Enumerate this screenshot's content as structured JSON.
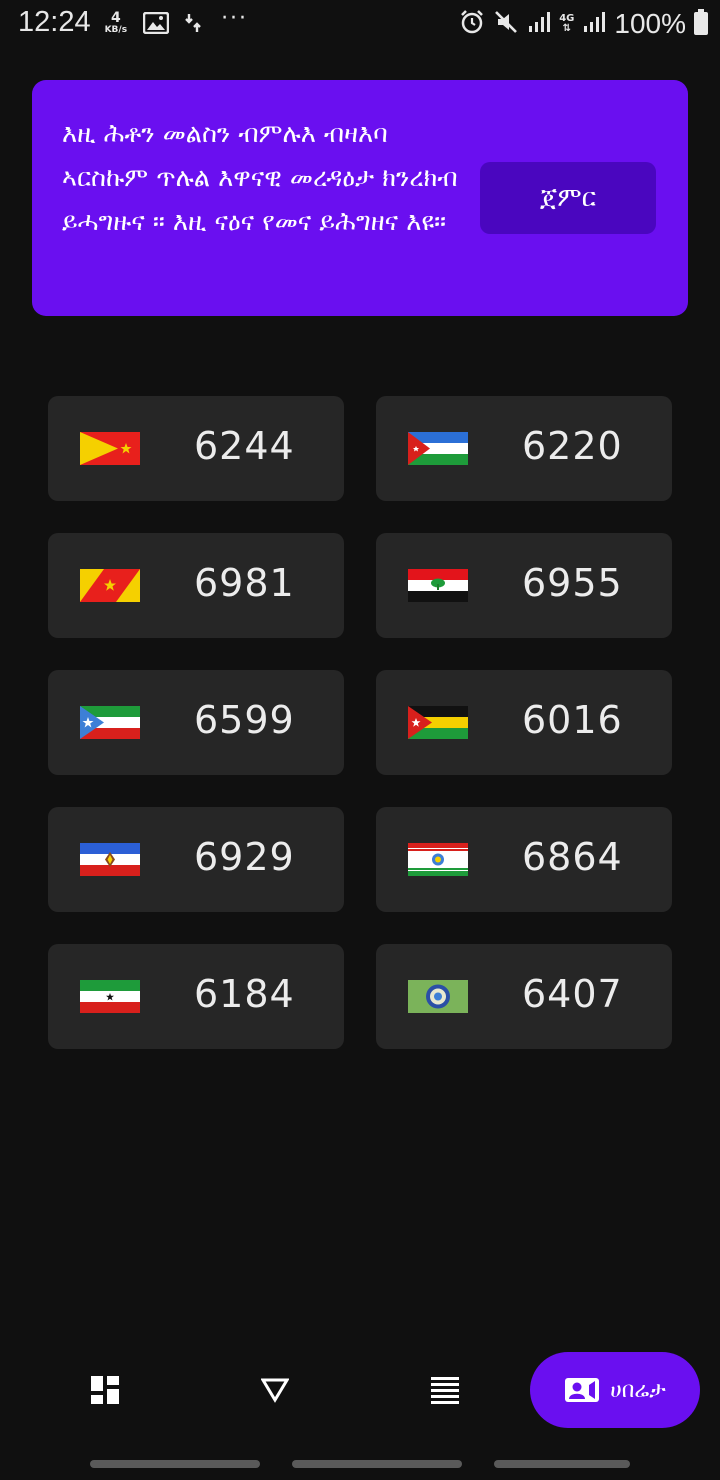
{
  "status_bar": {
    "time": "12:24",
    "net_speed_value": "4",
    "net_speed_unit": "KB/s",
    "network_type": "4G",
    "battery_text": "100%"
  },
  "banner": {
    "text": "እዚ ሕቶን መልስን ብምሉእ ብዛእባ ኣርስኩም ጥሉል እዋናዊ መረዳዕታ ክንረክብ ይሓግዙና ። እዚ ናዕና የመና ይሕግዘና እዩ።",
    "start_button": "ጀምር"
  },
  "cards": [
    {
      "number": "6244",
      "flag": "tigray-flag"
    },
    {
      "number": "6220",
      "flag": "afar-flag"
    },
    {
      "number": "6981",
      "flag": "tigray-alt-flag"
    },
    {
      "number": "6955",
      "flag": "oromia-flag"
    },
    {
      "number": "6599",
      "flag": "somali-flag"
    },
    {
      "number": "6016",
      "flag": "benishangul-flag"
    },
    {
      "number": "6929",
      "flag": "sidama-flag"
    },
    {
      "number": "6864",
      "flag": "amhara-flag"
    },
    {
      "number": "6184",
      "flag": "somaliland-flag"
    },
    {
      "number": "6407",
      "flag": "emblem-flag"
    }
  ],
  "bottom_nav": {
    "profile_label": "ሀበሬታ"
  },
  "colors": {
    "accent": "#6a0ff0",
    "accent_dark": "#4a06bf",
    "background": "#101010",
    "card": "#262626"
  }
}
